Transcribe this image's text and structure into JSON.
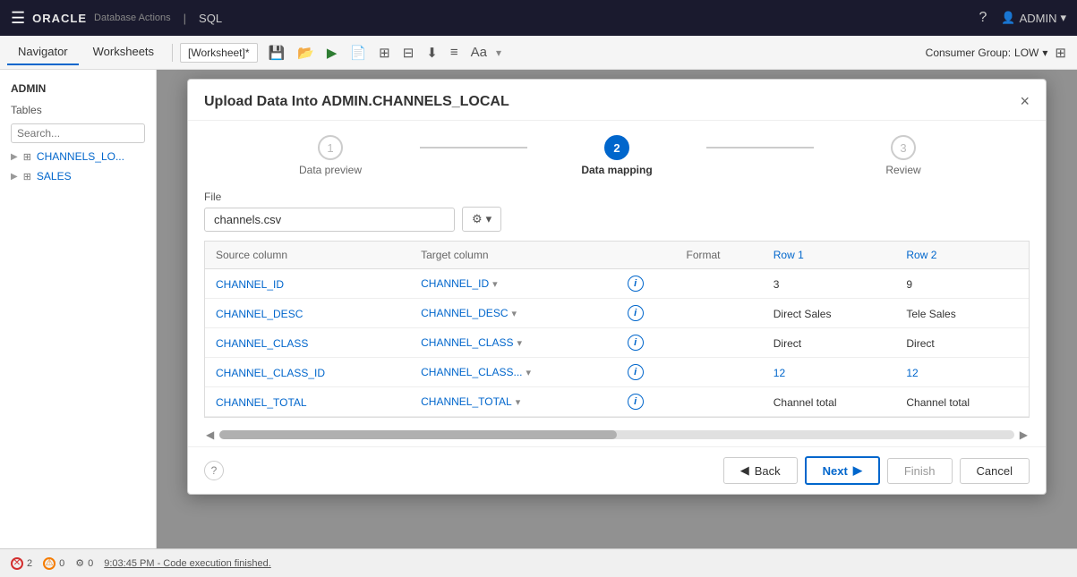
{
  "topbar": {
    "menu_icon": "☰",
    "logo": "ORACLE",
    "app_name": "Database Actions",
    "separator": "|",
    "section": "SQL",
    "help_icon": "?",
    "user_label": "ADMIN",
    "user_arrow": "▾"
  },
  "toolbar": {
    "tabs": [
      {
        "label": "Navigator",
        "active": false
      },
      {
        "label": "Worksheets",
        "active": false
      }
    ],
    "worksheet_tab": "[Worksheet]*",
    "run_icon": "▶",
    "consumer_group_label": "Consumer Group:",
    "consumer_group_value": "LOW"
  },
  "sidebar": {
    "section_label": "ADMIN",
    "subsection_label": "Tables",
    "search_placeholder": "Search...",
    "items": [
      {
        "label": "CHANNELS_LO..."
      },
      {
        "label": "SALES"
      }
    ]
  },
  "modal": {
    "title": "Upload Data Into ADMIN.CHANNELS_LOCAL",
    "close_label": "×",
    "steps": [
      {
        "number": "1",
        "label": "Data preview",
        "state": "inactive"
      },
      {
        "number": "2",
        "label": "Data mapping",
        "state": "active"
      },
      {
        "number": "3",
        "label": "Review",
        "state": "inactive"
      }
    ],
    "file_section": {
      "label": "File",
      "filename": "channels.csv",
      "settings_icon": "⚙",
      "settings_arrow": "▾"
    },
    "table": {
      "headers": [
        "Source column",
        "Target column",
        "",
        "Format",
        "Row 1",
        "Row 2"
      ],
      "rows": [
        {
          "source": "CHANNEL_ID",
          "target": "CHANNEL_ID",
          "format": "",
          "row1": "3",
          "row2": "9",
          "row1_blue": false,
          "row2_blue": false
        },
        {
          "source": "CHANNEL_DESC",
          "target": "CHANNEL_DESC",
          "format": "",
          "row1": "Direct Sales",
          "row2": "Tele Sales",
          "row1_blue": false,
          "row2_blue": false
        },
        {
          "source": "CHANNEL_CLASS",
          "target": "CHANNEL_CLASS",
          "format": "",
          "row1": "Direct",
          "row2": "Direct",
          "row1_blue": false,
          "row2_blue": false
        },
        {
          "source": "CHANNEL_CLASS_ID",
          "target": "CHANNEL_CLASS...",
          "format": "",
          "row1": "12",
          "row2": "12",
          "row1_blue": true,
          "row2_blue": true
        },
        {
          "source": "CHANNEL_TOTAL",
          "target": "CHANNEL_TOTAL",
          "format": "",
          "row1": "Channel total",
          "row2": "Channel total",
          "row1_blue": false,
          "row2_blue": false
        }
      ]
    },
    "footer": {
      "help_icon": "?",
      "back_label": "Back",
      "next_label": "Next",
      "finish_label": "Finish",
      "cancel_label": "Cancel"
    }
  },
  "statusbar": {
    "errors": "2",
    "warnings": "0",
    "gears": "0",
    "message": "9:03:45 PM - Code execution finished."
  }
}
